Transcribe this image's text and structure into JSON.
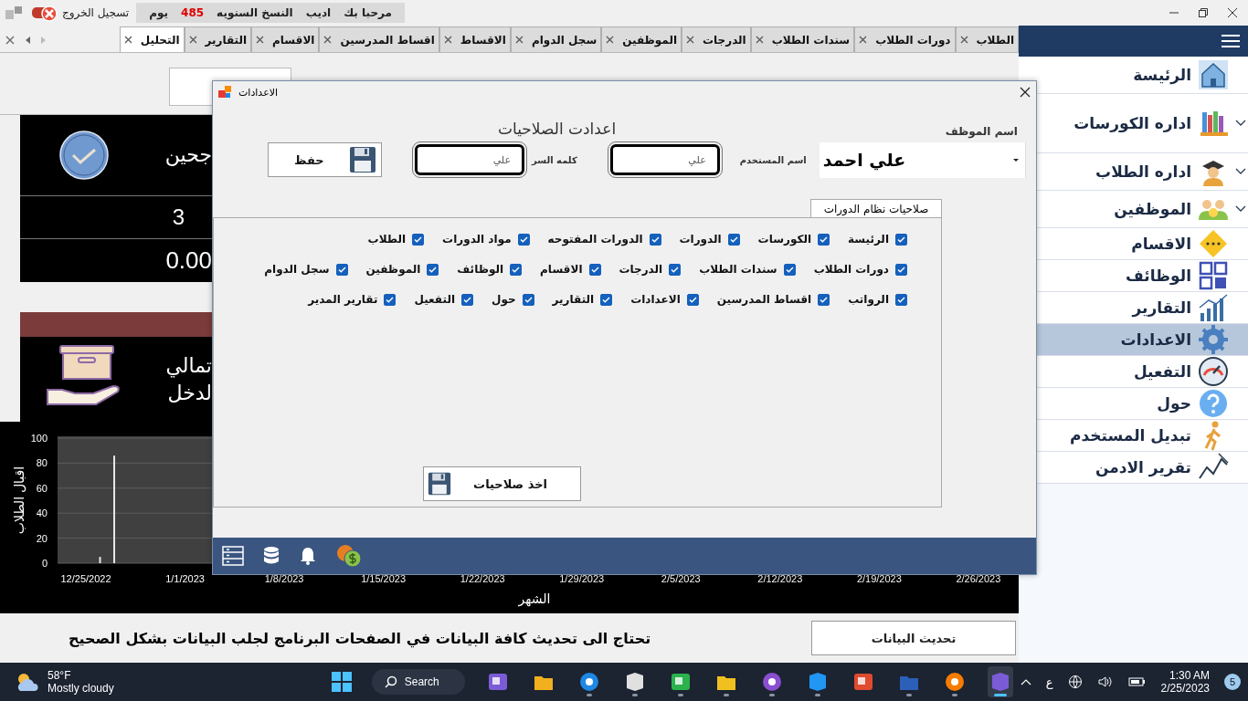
{
  "top_bar": {
    "logout": "تسجيل الخروج",
    "greeting": "مرحبا بك",
    "user": "اديب",
    "license_label": "النسخ السنويه",
    "days_left": "485",
    "days_unit": "يوم"
  },
  "tabs": [
    {
      "label": "الطلاب",
      "selected": false
    },
    {
      "label": "دورات الطلاب",
      "selected": false
    },
    {
      "label": "سندات الطلاب",
      "selected": false
    },
    {
      "label": "الدرجات",
      "selected": false
    },
    {
      "label": "الموظفين",
      "selected": false
    },
    {
      "label": "سجل الدوام",
      "selected": false
    },
    {
      "label": "الاقساط",
      "selected": false
    },
    {
      "label": "اقساط المدرسين",
      "selected": false
    },
    {
      "label": "الاقسام",
      "selected": false
    },
    {
      "label": "التقارير",
      "selected": false
    },
    {
      "label": "التحليل",
      "selected": true
    }
  ],
  "sidebar": {
    "items": [
      {
        "label": "الرئيسة",
        "has_submenu": false,
        "selected": false
      },
      {
        "label": "اداره الكورسات",
        "has_submenu": true,
        "selected": false
      },
      {
        "label": "اداره الطلاب",
        "has_submenu": true,
        "selected": false
      },
      {
        "label": "الموظفين",
        "has_submenu": true,
        "selected": false
      },
      {
        "label": "الاقسام",
        "has_submenu": false,
        "selected": false
      },
      {
        "label": "الوظائف",
        "has_submenu": false,
        "selected": false
      },
      {
        "label": "التقارير",
        "has_submenu": false,
        "selected": false
      },
      {
        "label": "الاعدادات",
        "has_submenu": false,
        "selected": true
      },
      {
        "label": "التفعيل",
        "has_submenu": false,
        "selected": false
      },
      {
        "label": "حول",
        "has_submenu": false,
        "selected": false
      },
      {
        "label": "تبديل المستخدم",
        "has_submenu": false,
        "selected": false
      },
      {
        "label": "تقرير الادمن",
        "has_submenu": false,
        "selected": false
      }
    ]
  },
  "dashboard": {
    "card_title": "جحين",
    "card_count": "3",
    "card_amount": "0.00",
    "income_lines": [
      "تمالي",
      "لدخل"
    ]
  },
  "chart": {
    "chart_data": {
      "type": "bar",
      "grid": true,
      "xlabel": "الشهر",
      "ylabel": "اقبال الطلاب",
      "ylim": [
        0,
        100
      ],
      "yticks": [
        0,
        20,
        40,
        60,
        80,
        100
      ],
      "categories": [
        null,
        null,
        "12/25/2022",
        null,
        null,
        null,
        null,
        null,
        null,
        "1/1/2023",
        null,
        null,
        null,
        null,
        null,
        null,
        "1/8/2023",
        null,
        null,
        null,
        null,
        null,
        null,
        "1/15/2023",
        null,
        null,
        null,
        null,
        null,
        null,
        "1/22/2023",
        null,
        null,
        null,
        null,
        null,
        null,
        "1/29/2023",
        null,
        null,
        null,
        null,
        null,
        null,
        "2/5/2023",
        null,
        null,
        null,
        null,
        null,
        null,
        "2/12/2023",
        null,
        null,
        null,
        null,
        null,
        null,
        "2/19/2023",
        null,
        null,
        null,
        null,
        null,
        null,
        "2/26/2023",
        null,
        null
      ],
      "values": [
        null,
        null,
        null,
        5,
        86,
        null,
        null,
        null,
        null,
        null,
        null,
        null,
        null,
        null,
        null,
        null,
        null,
        null,
        null,
        null,
        null,
        null,
        null,
        null,
        null,
        null,
        null,
        null,
        null,
        null,
        null,
        null,
        null,
        null,
        null,
        null,
        null,
        null,
        null,
        null,
        null,
        null,
        null,
        null,
        null,
        null,
        null,
        null,
        null,
        null,
        null,
        null,
        null,
        null,
        null,
        null,
        null,
        null,
        null,
        null,
        null,
        null,
        null,
        null,
        null,
        null,
        null,
        null
      ]
    }
  },
  "notice": {
    "text": "تحتاج الى تحديث كافة البيانات في الصفحات البرنامج لجلب البيانات بشكل الصحيح",
    "refresh_button": "تحديث البيانات"
  },
  "dialog": {
    "title": "الاعدادات",
    "heading": "اعدادت الصلاحيات",
    "employee_label": "اسم الموظف",
    "employee": "علي احمد",
    "username_label": "اسم المستخدم",
    "username": "علي",
    "password_label": "كلمه السر",
    "password": "علي",
    "save_button": "حفظ",
    "group_tab": "صلاحيات نظام الدورات",
    "permission_rows": [
      [
        {
          "label": "الرئيسة",
          "checked": true
        },
        {
          "label": "الكورسات",
          "checked": true
        },
        {
          "label": "الدورات",
          "checked": true
        },
        {
          "label": "الدورات المفتوحه",
          "checked": true
        },
        {
          "label": "مواد الدورات",
          "checked": true
        },
        {
          "label": "الطلاب",
          "checked": true
        }
      ],
      [
        {
          "label": "دورات الطلاب",
          "checked": true
        },
        {
          "label": "سندات الطلاب",
          "checked": true
        },
        {
          "label": "الدرجات",
          "checked": true
        },
        {
          "label": "الاقسام",
          "checked": true
        },
        {
          "label": "الوظائف",
          "checked": true
        },
        {
          "label": "الموظفين",
          "checked": true
        },
        {
          "label": "سجل الدوام",
          "checked": true
        }
      ],
      [
        {
          "label": "الرواتب",
          "checked": true
        },
        {
          "label": "اقساط المدرسين",
          "checked": true
        },
        {
          "label": "الاعدادات",
          "checked": true
        },
        {
          "label": "التقارير",
          "checked": true
        },
        {
          "label": "حول",
          "checked": true
        },
        {
          "label": "التفعيل",
          "checked": true
        },
        {
          "label": "تقارير المدير",
          "checked": true
        }
      ]
    ],
    "grant_button": "اخذ صلاحيات"
  },
  "taskbar": {
    "temperature": "58°F",
    "weather": "Mostly cloudy",
    "search": "Search",
    "input_language": "ع",
    "time": "1:30 AM",
    "date": "2/25/2023",
    "notifications": "5",
    "apps": [
      {
        "running": false,
        "active": false
      },
      {
        "running": false,
        "active": false
      },
      {
        "running": true,
        "active": false
      },
      {
        "running": true,
        "active": false
      },
      {
        "running": true,
        "active": false
      },
      {
        "running": true,
        "active": false
      },
      {
        "running": true,
        "active": false
      },
      {
        "running": true,
        "active": false
      },
      {
        "running": false,
        "active": false
      },
      {
        "running": true,
        "active": false
      },
      {
        "running": true,
        "active": false
      },
      {
        "running": true,
        "active": true
      }
    ]
  }
}
